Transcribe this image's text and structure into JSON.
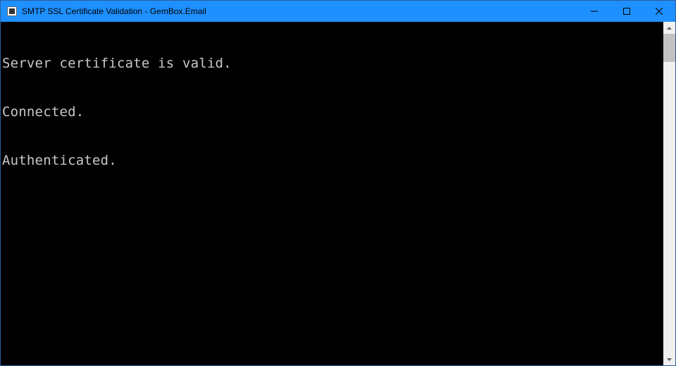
{
  "window": {
    "title": "SMTP SSL Certificate Validation - GemBox.Email"
  },
  "console": {
    "lines": [
      "Server certificate is valid.",
      "Connected.",
      "Authenticated."
    ]
  }
}
